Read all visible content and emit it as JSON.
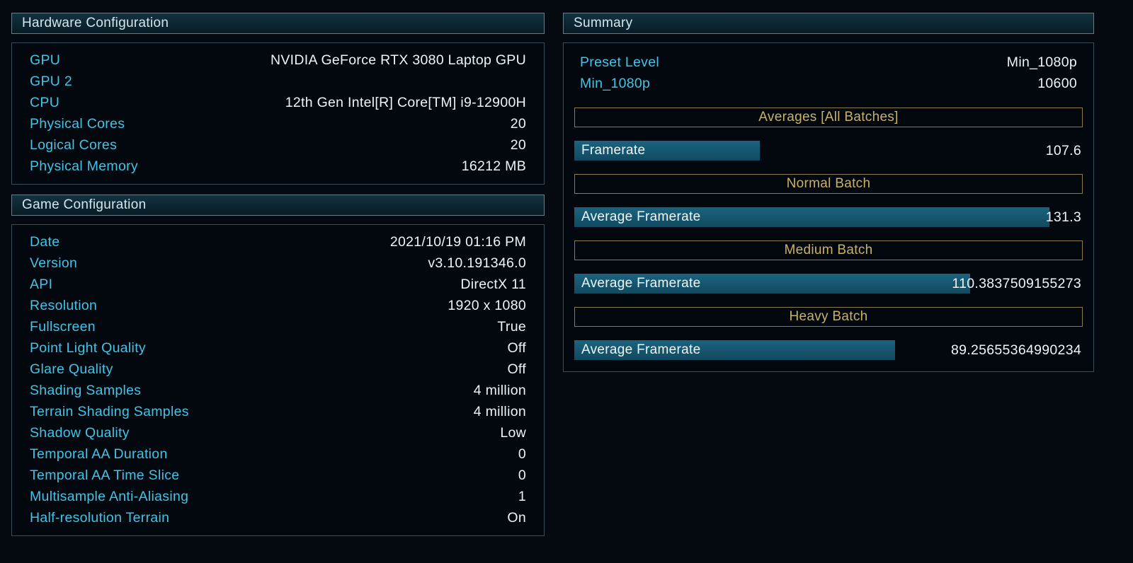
{
  "colors": {
    "background": "#050a10",
    "header_bg_top": "#123240",
    "header_bg_bottom": "#081c25",
    "header_border": "#6b7a84",
    "box_border": "#3d4c56",
    "label": "#41c4e6",
    "value": "#ecf6fa",
    "gold_text": "#c9b264",
    "gold_border": "#8c7c48",
    "bar_fill": "#124a60"
  },
  "hardware_configuration": {
    "title": "Hardware Configuration",
    "rows": [
      {
        "label": "GPU",
        "value": "NVIDIA GeForce RTX 3080 Laptop GPU"
      },
      {
        "label": "GPU 2",
        "value": ""
      },
      {
        "label": "CPU",
        "value": "12th Gen Intel[R] Core[TM] i9-12900H"
      },
      {
        "label": "Physical Cores",
        "value": "20"
      },
      {
        "label": "Logical Cores",
        "value": "20"
      },
      {
        "label": "Physical Memory",
        "value": "16212 MB"
      }
    ]
  },
  "game_configuration": {
    "title": "Game Configuration",
    "rows": [
      {
        "label": "Date",
        "value": "2021/10/19 01:16 PM"
      },
      {
        "label": "Version",
        "value": "v3.10.191346.0"
      },
      {
        "label": "API",
        "value": "DirectX 11"
      },
      {
        "label": "Resolution",
        "value": "1920 x 1080"
      },
      {
        "label": "Fullscreen",
        "value": "True"
      },
      {
        "label": "Point Light Quality",
        "value": "Off"
      },
      {
        "label": "Glare Quality",
        "value": "Off"
      },
      {
        "label": "Shading Samples",
        "value": "4 million"
      },
      {
        "label": "Terrain Shading Samples",
        "value": "4 million"
      },
      {
        "label": "Shadow Quality",
        "value": "Low"
      },
      {
        "label": "Temporal AA Duration",
        "value": "0"
      },
      {
        "label": "Temporal AA Time Slice",
        "value": "0"
      },
      {
        "label": "Multisample Anti-Aliasing",
        "value": "1"
      },
      {
        "label": "Half-resolution Terrain",
        "value": "On"
      }
    ]
  },
  "summary": {
    "title": "Summary",
    "preset": {
      "label": "Preset Level",
      "value": "Min_1080p"
    },
    "score": {
      "label": "Min_1080p",
      "value": "10600"
    },
    "sections": [
      {
        "header": "Averages [All Batches]",
        "metric_label": "Framerate",
        "metric_value": "107.6",
        "bar_pct": 36.5
      },
      {
        "header": "Normal Batch",
        "metric_label": "Average Framerate",
        "metric_value": "131.3",
        "bar_pct": 93.5
      },
      {
        "header": "Medium Batch",
        "metric_label": "Average Framerate",
        "metric_value": "110.3837509155273",
        "bar_pct": 77.8
      },
      {
        "header": "Heavy Batch",
        "metric_label": "Average Framerate",
        "metric_value": "89.25655364990234",
        "bar_pct": 63.1
      }
    ]
  }
}
